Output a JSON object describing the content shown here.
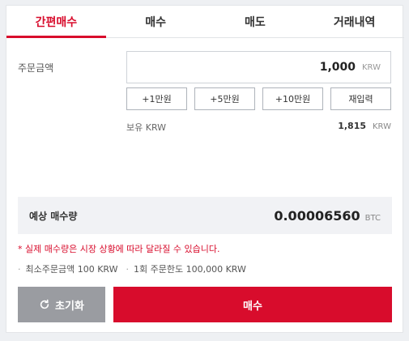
{
  "tabs": [
    {
      "label": "간편매수",
      "active": true
    },
    {
      "label": "매수",
      "active": false
    },
    {
      "label": "매도",
      "active": false
    },
    {
      "label": "거래내역",
      "active": false
    }
  ],
  "order": {
    "amount_label": "주문금액",
    "amount_value": "1,000",
    "amount_unit": "KRW"
  },
  "quick_buttons": [
    "+1만원",
    "+5만원",
    "+10만원",
    "재입력"
  ],
  "holding": {
    "label": "보유 KRW",
    "value": "1,815",
    "unit": "KRW"
  },
  "expected": {
    "label": "예상 매수량",
    "value": "0.00006560",
    "unit": "BTC"
  },
  "notes": {
    "warning": "* 실제 매수량은 시장 상황에 따라 달라질 수 있습니다.",
    "min_order": "최소주문금액 100 KRW",
    "max_order": "1회 주문한도 100,000 KRW"
  },
  "actions": {
    "reset_label": "초기화",
    "buy_label": "매수"
  },
  "colors": {
    "accent": "#d80c2c",
    "reset_bg": "#9a9ca1",
    "expected_bg": "#f1f2f5"
  }
}
